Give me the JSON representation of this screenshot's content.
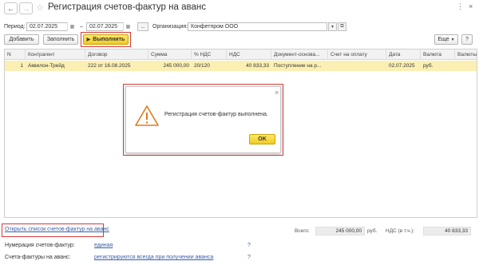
{
  "window": {
    "title": "Регистрация счетов-фактур на аванс",
    "more_icon": "⋮",
    "close_icon": "×",
    "link_icon": "🔗"
  },
  "filters": {
    "period_label": "Период:",
    "date_from": "02.07.2025",
    "dash": "–",
    "date_to": "02.07.2025",
    "dots_label": "...",
    "org_label": "Организация:",
    "org_value": "Конфетпром ООО"
  },
  "toolbar": {
    "add_label": "Добавить",
    "fill_label": "Заполнить",
    "run_label": "Выполнить",
    "more_label": "Еще",
    "help_label": "?"
  },
  "table": {
    "headers": [
      "N",
      "Контрагент",
      "Договор",
      "Сумма",
      "% НДС",
      "НДС",
      "Документ-основа...",
      "Счет на оплату",
      "Дата",
      "Валюта",
      "Валюты"
    ],
    "rows": [
      [
        "1",
        "Аквилон-Трейд",
        "222 от 16.08.2025",
        "245 000,00",
        "20/120",
        "40 833,33",
        "Поступление на р...",
        "",
        "02.07.2025",
        "руб.",
        ""
      ]
    ]
  },
  "dialog": {
    "message": "Регистрация счетов-фактур выполнена.",
    "ok_label": "OK",
    "close_label": "×"
  },
  "footer": {
    "open_list_link": "Открыть список счетов-фактур на аванс",
    "numbering_label": "Нумерация счетов-фактур:",
    "numbering_value": "единая",
    "registration_label": "Счета-фактуры на аванс:",
    "registration_value": "регистрируются всегда при получении аванса",
    "help_q": "?",
    "total_label": "Всего:",
    "total_value": "245 000,00",
    "currency": "руб.",
    "vat_label": "НДС (в т.ч.):",
    "vat_value": "40 833,33"
  },
  "colors": {
    "accent_yellow": "#f2cc1e",
    "selected_row": "#fbefb3",
    "highlight_red": "#d63b3b",
    "link_blue": "#3a5ea8"
  }
}
